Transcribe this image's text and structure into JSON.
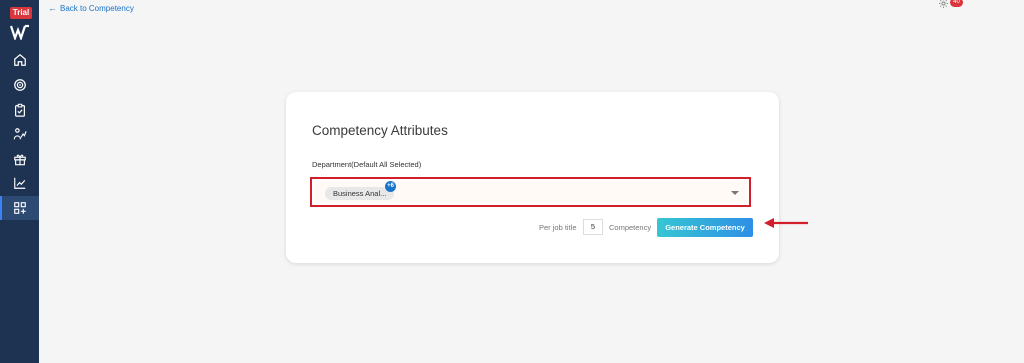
{
  "sidebar": {
    "trial_badge": "Trial",
    "logo": "W",
    "items": [
      {
        "name": "home-icon"
      },
      {
        "name": "target-icon"
      },
      {
        "name": "clipboard-check-icon"
      },
      {
        "name": "person-chart-icon"
      },
      {
        "name": "gift-icon"
      },
      {
        "name": "line-chart-icon"
      },
      {
        "name": "grid-add-icon",
        "active": true
      }
    ]
  },
  "header": {
    "back_link": "Back to Competency",
    "notification_count": "40"
  },
  "card": {
    "title": "Competency Attributes",
    "department_label": "Department(Default All Selected)",
    "selected_tag": "Business Anal...",
    "more_count": "+6",
    "per_job_title_label": "Per job title",
    "per_job_title_value": "5",
    "competency_label": "Competency",
    "generate_button": "Generate Competency"
  },
  "colors": {
    "sidebar": "#1e3252",
    "accent": "#1a73c9",
    "highlight": "#d11f2b"
  }
}
